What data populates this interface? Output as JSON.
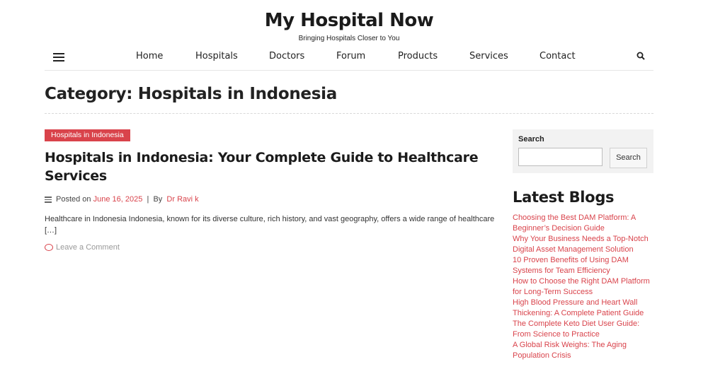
{
  "header": {
    "site_title": "My Hospital Now",
    "tagline": "Bringing Hospitals Closer to You"
  },
  "nav": {
    "items": [
      "Home",
      "Hospitals",
      "Doctors",
      "Forum",
      "Products",
      "Services",
      "Contact"
    ]
  },
  "category": {
    "title": "Category: Hospitals in Indonesia"
  },
  "post": {
    "badge": "Hospitals in Indonesia",
    "title": "Hospitals in Indonesia: Your Complete Guide to Healthcare Services",
    "posted_on_label": "Posted on",
    "date": "June 16, 2025",
    "separator": "|",
    "by_label": "By",
    "author": "Dr Ravi k",
    "excerpt": "Healthcare in Indonesia Indonesia, known for its diverse culture, rich history, and vast geography, offers a wide range of healthcare […]",
    "comment_link": "Leave a Comment"
  },
  "sidebar": {
    "search": {
      "label": "Search",
      "input_value": "",
      "button_label": "Search"
    },
    "latest_blogs": {
      "heading": "Latest Blogs",
      "items": [
        "Choosing the Best DAM Platform: A Beginner’s Decision Guide",
        "Why Your Business Needs a Top-Notch Digital Asset Management Solution",
        "10 Proven Benefits of Using DAM Systems for Team Efficiency",
        "How to Choose the Right DAM Platform for Long-Term Success",
        "High Blood Pressure and Heart Wall Thickening: A Complete Patient Guide",
        "The Complete Keto Diet User Guide: From Science to Practice",
        "A Global Risk Weighs: The Aging Population Crisis"
      ]
    }
  },
  "colors": {
    "accent": "#d9434b",
    "text": "#222222"
  },
  "icons": {
    "menu": "hamburger-menu-icon",
    "search": "search-icon",
    "meta": "list-icon",
    "comment": "comment-icon"
  }
}
